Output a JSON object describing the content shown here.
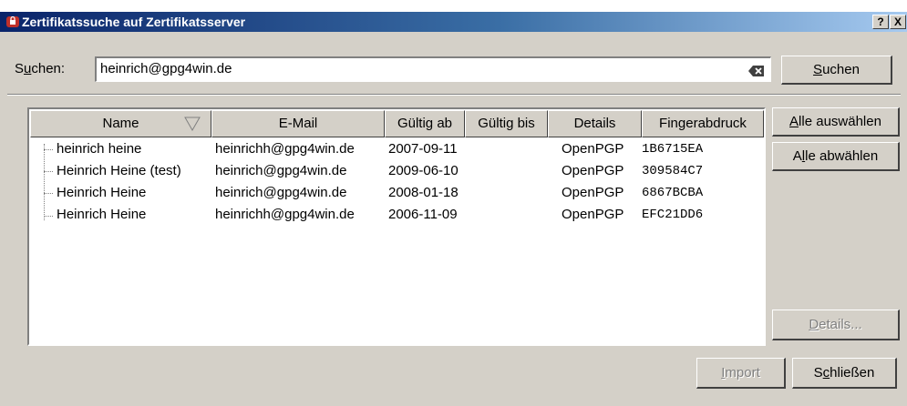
{
  "window": {
    "title": "Zertifikatssuche auf Zertifikatsserver",
    "help_button": "?",
    "close_button": "X"
  },
  "search": {
    "label_prefix": "S",
    "label_underlined": "u",
    "label_suffix": "chen:",
    "value": "heinrich@gpg4win.de",
    "button_underlined": "S",
    "button_rest": "uchen"
  },
  "table": {
    "headers": [
      "Name",
      "E-Mail",
      "Gültig ab",
      "Gültig bis",
      "Details",
      "Fingerabdruck"
    ],
    "rows": [
      {
        "name": "heinrich heine",
        "email": "heinrichh@gpg4win.de",
        "valid_from": "2007-09-11",
        "valid_to": "",
        "details": "OpenPGP",
        "fingerprint": "1B6715EA"
      },
      {
        "name": "Heinrich Heine (test)",
        "email": "heinrich@gpg4win.de",
        "valid_from": "2009-06-10",
        "valid_to": "",
        "details": "OpenPGP",
        "fingerprint": "309584C7"
      },
      {
        "name": "Heinrich Heine",
        "email": "heinrich@gpg4win.de",
        "valid_from": "2008-01-18",
        "valid_to": "",
        "details": "OpenPGP",
        "fingerprint": "6867BCBA"
      },
      {
        "name": "Heinrich Heine",
        "email": "heinrichh@gpg4win.de",
        "valid_from": "2006-11-09",
        "valid_to": "",
        "details": "OpenPGP",
        "fingerprint": "EFC21DD6"
      }
    ]
  },
  "buttons": {
    "select_all_u": "A",
    "select_all_rest": "lle auswählen",
    "deselect_all_a": "A",
    "deselect_all_u": "l",
    "deselect_all_rest": "le abwählen",
    "details_u": "D",
    "details_rest": "etails...",
    "import_u": "I",
    "import_rest": "mport",
    "close_s": "S",
    "close_u": "c",
    "close_rest": "hließen"
  },
  "colors": {
    "title_start": "#0a246a",
    "title_end": "#a6caf0",
    "face": "#d4d0c8"
  }
}
